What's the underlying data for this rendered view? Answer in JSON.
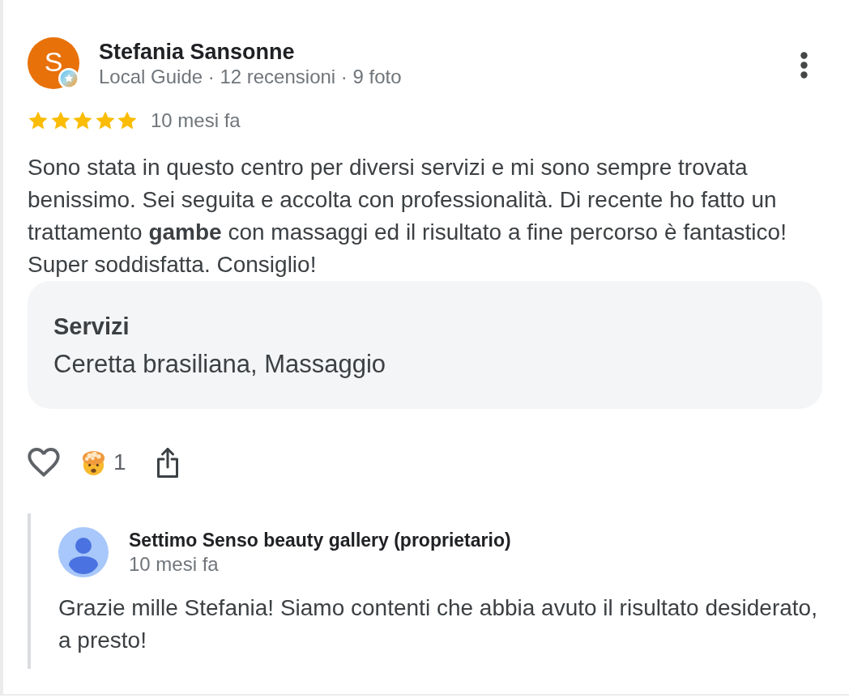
{
  "review": {
    "author": {
      "name": "Stefania Sansonne",
      "initial": "S",
      "local_guide": true,
      "meta": "Local Guide · 12 recensioni · 9 foto"
    },
    "stars": 5,
    "time": "10 mesi fa",
    "text": "Sono stata in questo centro per diversi servizi e mi sono sempre trovata benissimo. Sei seguita e accolta con professionalità. Di recente ho fatto un trattamento **gambe** con massaggi ed il risultato a fine percorso è fantastico! Super soddisfatta. Consiglio!",
    "services": {
      "title": "Servizi",
      "value": "Ceretta brasiliana, Massaggio"
    },
    "actions": {
      "liked": false,
      "reaction_count": "1"
    },
    "reply": {
      "author": "Settimo Senso beauty gallery (proprietario)",
      "time": "10 mesi fa",
      "text": "Grazie mille Stefania! Siamo contenti che abbia avuto il risultato desiderato, a presto!"
    }
  }
}
